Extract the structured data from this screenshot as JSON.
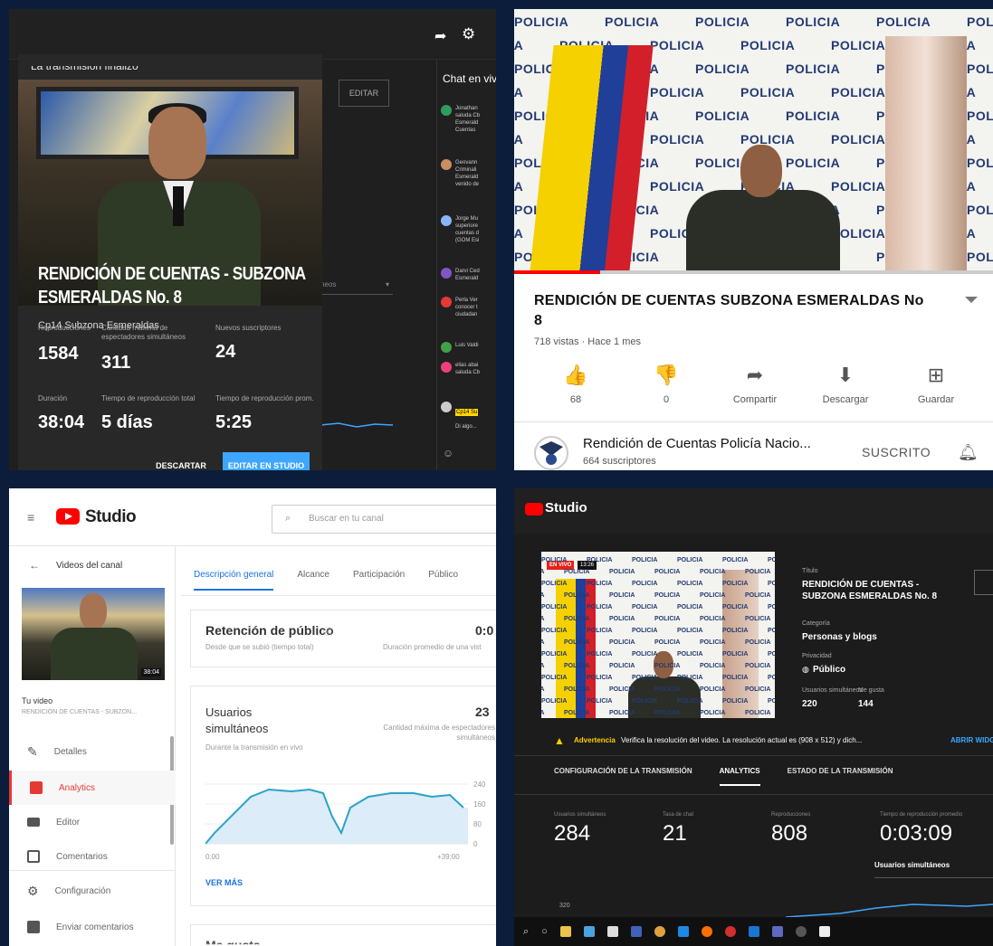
{
  "q1": {
    "header_partial": "La transmisión finalizó",
    "title": "RENDICIÓN DE CUENTAS - SUBZONA ESMERALDAS No. 8",
    "channel": "Cp14 Subzona Esmeraldas",
    "stats": [
      {
        "label": "Reproducciones",
        "value": "1584"
      },
      {
        "label": "Cantidad máxima de espectadores simultáneos",
        "value": "311"
      },
      {
        "label": "Nuevos suscriptores",
        "value": "24"
      },
      {
        "label": "Duración",
        "value": "38:04"
      },
      {
        "label": "Tiempo de reproducción total",
        "value": "5 días"
      },
      {
        "label": "Tiempo de reproducción prom.",
        "value": "5:25"
      }
    ],
    "discard_label": "DESCARTAR",
    "edit_studio_label": "EDITAR EN STUDIO",
    "edit_label": "EDITAR",
    "dropdown_partial": "neos",
    "chat": {
      "title": "Chat en vivo",
      "messages": [
        {
          "text": "Jonathan saluda Cb Esmerald Cuentas",
          "color": "#2e9e5b"
        },
        {
          "text": "Geovann Criminali Esmerald venido de",
          "color": "#c78f62"
        },
        {
          "text": "Jorge Mu superiore cuentas d (GOM Esi",
          "color": "#8ab4f8"
        },
        {
          "text": "Darvi Ced Esmerald",
          "color": "#7e57c2"
        },
        {
          "text": "Perla Ver conocer t ciudadan",
          "color": "#e53935"
        },
        {
          "text": "Luis Valdi",
          "color": "#43a047"
        },
        {
          "text": "elias abai saluda Cb",
          "color": "#ec407a"
        }
      ],
      "highlight": "Cp14 Su",
      "input_partial": "Di algo..."
    }
  },
  "q2": {
    "wall_text": "POLICIA",
    "title": "RENDICIÓN DE CUENTAS  SUBZONA ESMERALDAS No 8",
    "meta": "718 vistas · Hace 1 mes",
    "actions": [
      {
        "icon": "thumbs-up",
        "label": "68"
      },
      {
        "icon": "thumbs-down",
        "label": "0"
      },
      {
        "icon": "share",
        "label": "Compartir"
      },
      {
        "icon": "download",
        "label": "Descargar"
      },
      {
        "icon": "playlist-add",
        "label": "Guardar"
      }
    ],
    "channel_name": "Rendición de Cuentas Policía Nacio...",
    "subscribers": "664 suscriptores",
    "subscribed_label": "SUSCRITO"
  },
  "q3": {
    "studio_label": "Studio",
    "search_placeholder": "Buscar en tu canal",
    "back_label": "Videos del canal",
    "thumb_duration": "38:04",
    "your_video": "Tu video",
    "video_title_trunc": "RENDICIÓN DE CUENTAS - SUBZON...",
    "nav": [
      "Detalles",
      "Analytics",
      "Editor",
      "Comentarios",
      "Configuración",
      "Enviar comentarios"
    ],
    "tabs": [
      "Descripción general",
      "Alcance",
      "Participación",
      "Público"
    ],
    "retention": {
      "title": "Retención de público",
      "sub": "Desde que se subió (tiempo total)",
      "value_partial": "0:0",
      "right_label": "Duración promedio de una vist"
    },
    "concurrent": {
      "title": "Usuarios simultáneos",
      "sub": "Durante la transmisión en vivo",
      "value_partial": "23",
      "right_label": "Cantidad máxima de espectadores simultáneos",
      "y_ticks": [
        "240",
        "160",
        "80",
        "0"
      ],
      "x_start": "0:00",
      "x_end": "+39:00",
      "see_more": "VER MÁS"
    },
    "next_card_partial": "Me gusta"
  },
  "q4": {
    "studio_label": "Studio",
    "live_badge": "EN VIVO",
    "live_time": "13:26",
    "fields": [
      {
        "label": "Título",
        "value": "RENDICIÓN DE CUENTAS - SUBZONA ESMERALDAS No. 8"
      },
      {
        "label": "Categoría",
        "value": "Personas y blogs"
      },
      {
        "label": "Privacidad",
        "value": "Público"
      }
    ],
    "sim_label": "Usuarios simultáneos",
    "sim_value": "220",
    "likes_label": "Me gusta",
    "likes_value": "144",
    "warning_label": "Advertencia",
    "warning_text": "Verifica la resolución del video. La resolución actual es (908 x 512) y dich...",
    "warning_link": "ABRIR WIDG",
    "tabs": [
      "CONFIGURACIÓN DE LA TRANSMISIÓN",
      "ANALYTICS",
      "ESTADO DE LA TRANSMISIÓN"
    ],
    "metrics": [
      {
        "label": "Usuarios simultáneos",
        "value": "284"
      },
      {
        "label": "Tasa de chat",
        "value": "21"
      },
      {
        "label": "Reproducciones",
        "value": "808"
      },
      {
        "label": "Tiempo de reproducción promedio",
        "value": "0:03:09"
      }
    ],
    "graph_title": "Usuarios simultáneos",
    "graph_y": "320"
  }
}
